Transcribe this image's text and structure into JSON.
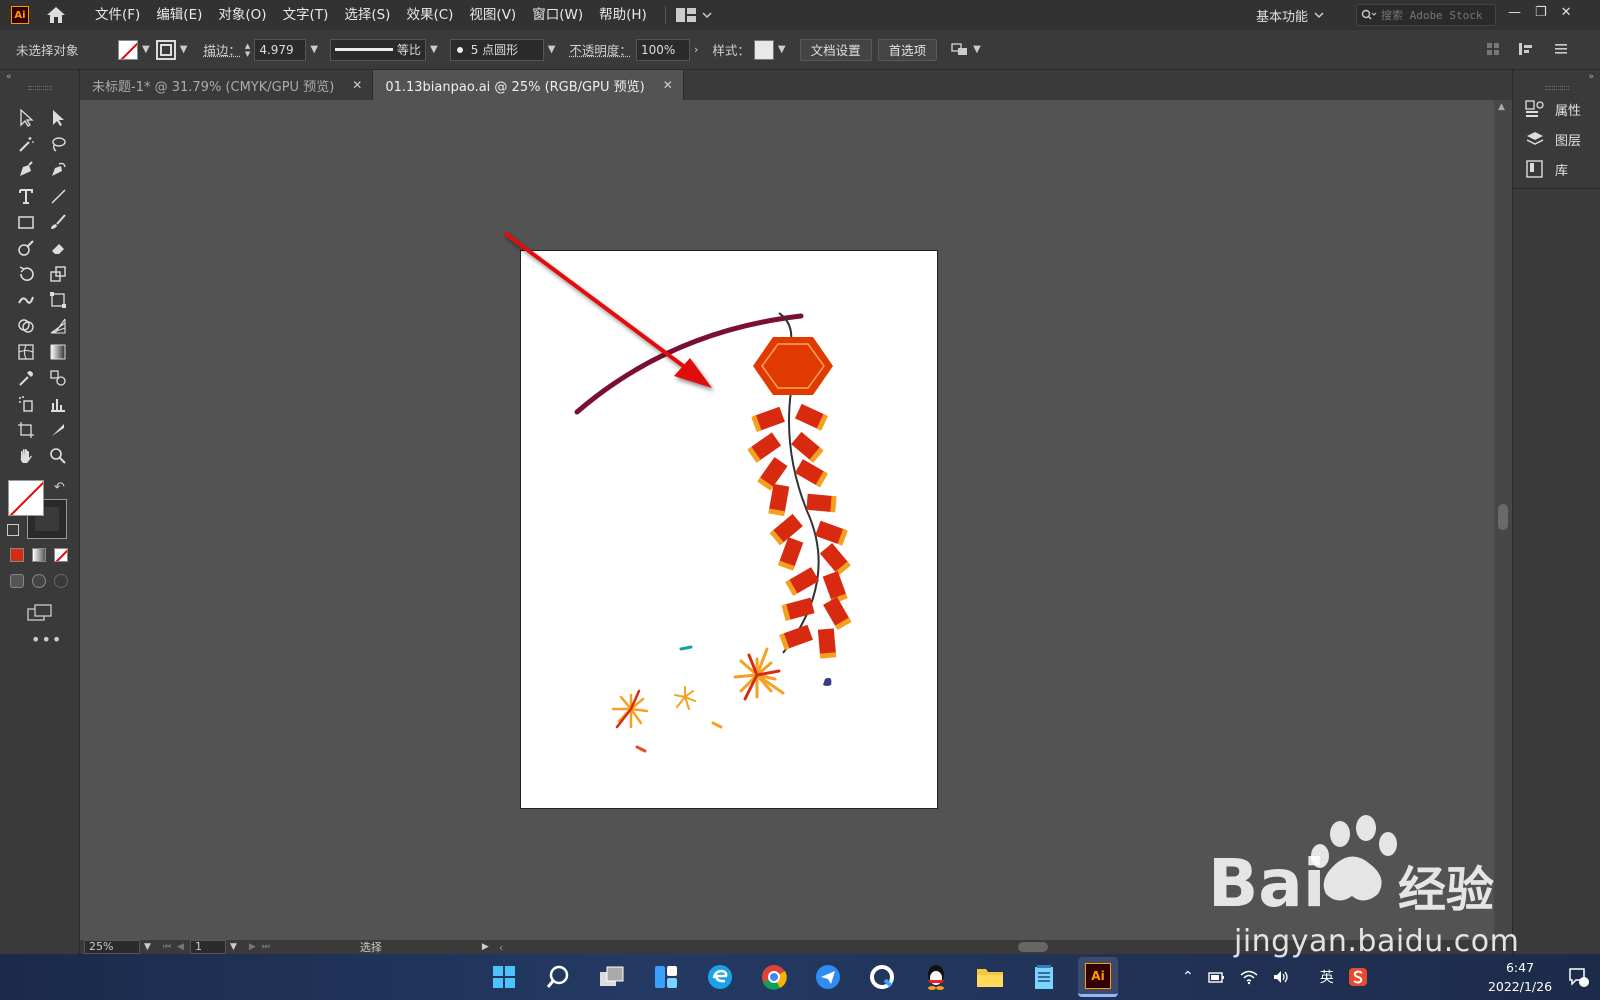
{
  "menubar": {
    "items": [
      "文件(F)",
      "编辑(E)",
      "对象(O)",
      "文字(T)",
      "选择(S)",
      "效果(C)",
      "视图(V)",
      "窗口(W)",
      "帮助(H)"
    ],
    "workspace": "基本功能",
    "stock_search_placeholder": "搜索 Adobe Stock"
  },
  "control": {
    "selection_status": "未选择对象",
    "stroke_label": "描边：",
    "stroke_weight": "4.979",
    "stroke_profile": "等比",
    "brush": "5 点圆形",
    "opacity_label": "不透明度：",
    "opacity_value": "100%",
    "style_label": "样式：",
    "doc_setup_button": "文档设置",
    "preferences_button": "首选项"
  },
  "tabs": [
    {
      "label": "未标题-1* @ 31.79% (CMYK/GPU 预览)",
      "active": false
    },
    {
      "label": "01.13bianpao.ai @ 25% (RGB/GPU 预览)",
      "active": true
    }
  ],
  "right_panel": {
    "items": [
      "属性",
      "图层",
      "库"
    ]
  },
  "status": {
    "zoom": "25%",
    "page": "1",
    "tool": "选择"
  },
  "taskbar": {
    "ime": "英",
    "time": "6:47",
    "date": "2022/1/26"
  },
  "watermark": {
    "text": "jingyan.baidu.com"
  },
  "colors": {
    "arrow_red": "#e01010",
    "stick": "#7a1030",
    "firecracker_red": "#d82a10",
    "firecracker_orange": "#f5a020",
    "hex_red": "#e03a00"
  }
}
